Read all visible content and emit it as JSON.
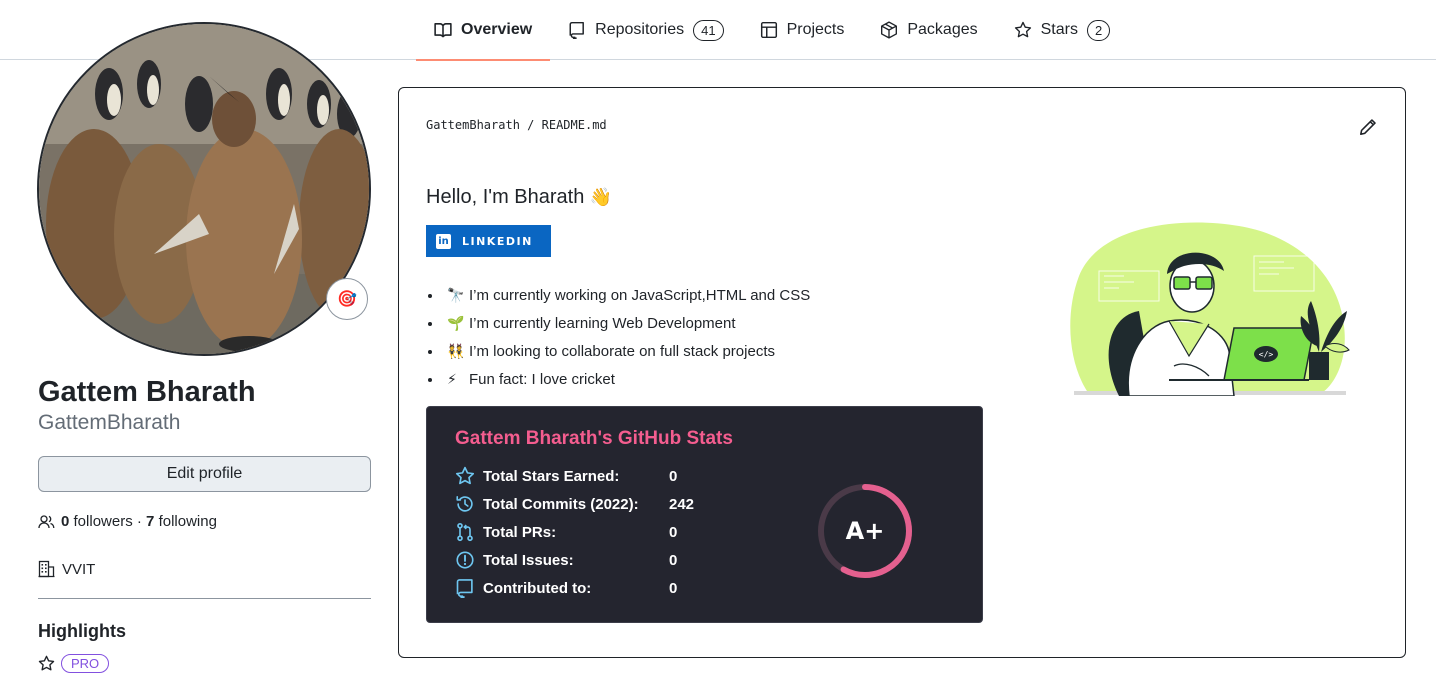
{
  "tabs": [
    {
      "label": "Overview",
      "icon": "book-icon",
      "active": true
    },
    {
      "label": "Repositories",
      "icon": "repo-icon",
      "count": "41"
    },
    {
      "label": "Projects",
      "icon": "table-icon"
    },
    {
      "label": "Packages",
      "icon": "package-icon"
    },
    {
      "label": "Stars",
      "icon": "star-icon",
      "count": "2"
    }
  ],
  "profile": {
    "name": "Gattem Bharath",
    "login": "GattemBharath",
    "edit_label": "Edit profile",
    "followers_count": "0",
    "followers_label": "followers",
    "separator": "·",
    "following_count": "7",
    "following_label": "following",
    "organization": "VVIT",
    "highlights_title": "Highlights",
    "pro_badge": "PRO",
    "status_emoji": "🎯"
  },
  "readme": {
    "owner": "GattemBharath",
    "separator": "/",
    "file": "README.md",
    "heading": "Hello, I'm Bharath",
    "heading_emoji": "👋",
    "linkedin_label": "LINKEDIN",
    "linkedin_logo": "in",
    "bullets": [
      {
        "emoji": "🔭",
        "text": "I’m currently working on JavaScript,HTML and CSS"
      },
      {
        "emoji": "🌱",
        "text": "I’m currently learning Web Development"
      },
      {
        "emoji": "👯",
        "text": "I’m looking to collaborate on full stack projects"
      },
      {
        "emoji": "⚡",
        "text": "Fun fact: I love cricket"
      }
    ]
  },
  "stats": {
    "title": "Gattem Bharath's GitHub Stats",
    "rows": [
      {
        "icon": "star-icon",
        "label": "Total Stars Earned:",
        "value": "0"
      },
      {
        "icon": "history-icon",
        "label": "Total Commits (2022):",
        "value": "242"
      },
      {
        "icon": "pull-request-icon",
        "label": "Total PRs:",
        "value": "0"
      },
      {
        "icon": "issue-icon",
        "label": "Total Issues:",
        "value": "0"
      },
      {
        "icon": "repo-icon",
        "label": "Contributed to:",
        "value": "0"
      }
    ],
    "grade": "A+",
    "grade_progress": 0.58,
    "colors": {
      "title": "#f45d8f",
      "icon": "#6ec6f0",
      "ring": "#e4608f",
      "bg": "#24252f"
    }
  },
  "colors": {
    "accent_tab": "#fd8c73",
    "linkedin": "#0a66c2",
    "pro": "#8250df",
    "illustration": "#d5f58a"
  }
}
